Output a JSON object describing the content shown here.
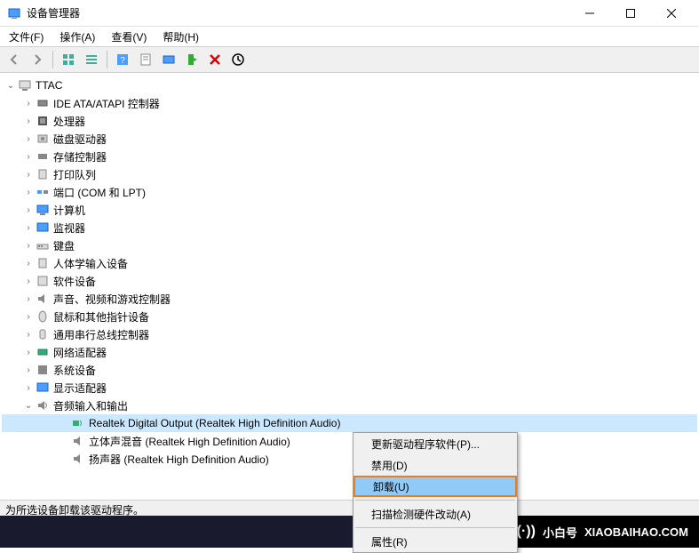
{
  "window": {
    "title": "设备管理器"
  },
  "menu": {
    "file": "文件(F)",
    "action": "操作(A)",
    "view": "查看(V)",
    "help": "帮助(H)"
  },
  "tree": {
    "root": "TTAC",
    "items": [
      "IDE ATA/ATAPI 控制器",
      "处理器",
      "磁盘驱动器",
      "存储控制器",
      "打印队列",
      "端口 (COM 和 LPT)",
      "计算机",
      "监视器",
      "键盘",
      "人体学输入设备",
      "软件设备",
      "声音、视频和游戏控制器",
      "鼠标和其他指针设备",
      "通用串行总线控制器",
      "网络适配器",
      "系统设备",
      "显示适配器",
      "音频输入和输出"
    ],
    "audio_children": [
      "Realtek Digital Output (Realtek High Definition Audio)",
      "立体声混音 (Realtek High Definition Audio)",
      "扬声器 (Realtek High Definition Audio)"
    ]
  },
  "context_menu": {
    "update_driver": "更新驱动程序软件(P)...",
    "disable": "禁用(D)",
    "uninstall": "卸载(U)",
    "scan": "扫描检测硬件改动(A)",
    "properties": "属性(R)"
  },
  "statusbar": "为所选设备卸载该驱动程序。",
  "watermark": {
    "brand": "小白号",
    "url": "XIAOBAIHAO.COM"
  }
}
